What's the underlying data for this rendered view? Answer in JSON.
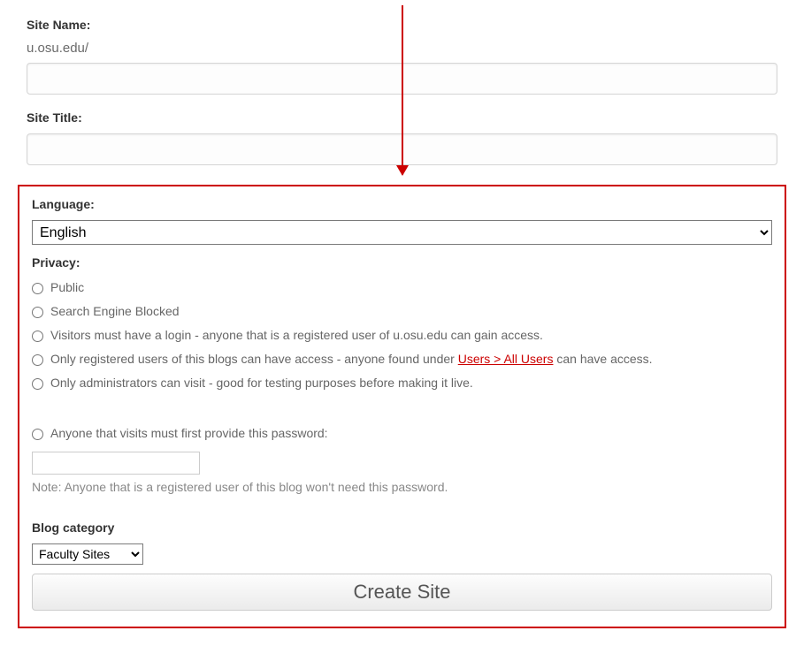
{
  "site_name": {
    "label": "Site Name:",
    "prefix": "u.osu.edu/",
    "value": ""
  },
  "site_title": {
    "label": "Site Title:",
    "value": ""
  },
  "language": {
    "label": "Language:",
    "selected": "English"
  },
  "privacy": {
    "label": "Privacy:",
    "options": {
      "public": "Public",
      "seb": "Search Engine Blocked",
      "login": "Visitors must have a login - anyone that is a registered user of u.osu.edu can gain access.",
      "reg_pre": "Only registered users of this blogs can have access - anyone found under ",
      "reg_link": "Users > All Users",
      "reg_post": " can have access.",
      "admin": "Only administrators can visit - good for testing purposes before making it live.",
      "password": "Anyone that visits must first provide this password:"
    },
    "password_value": "",
    "note": "Note: Anyone that is a registered user of this blog won't need this password."
  },
  "blog_category": {
    "label": "Blog category",
    "selected": "Faculty Sites"
  },
  "submit_label": "Create Site"
}
